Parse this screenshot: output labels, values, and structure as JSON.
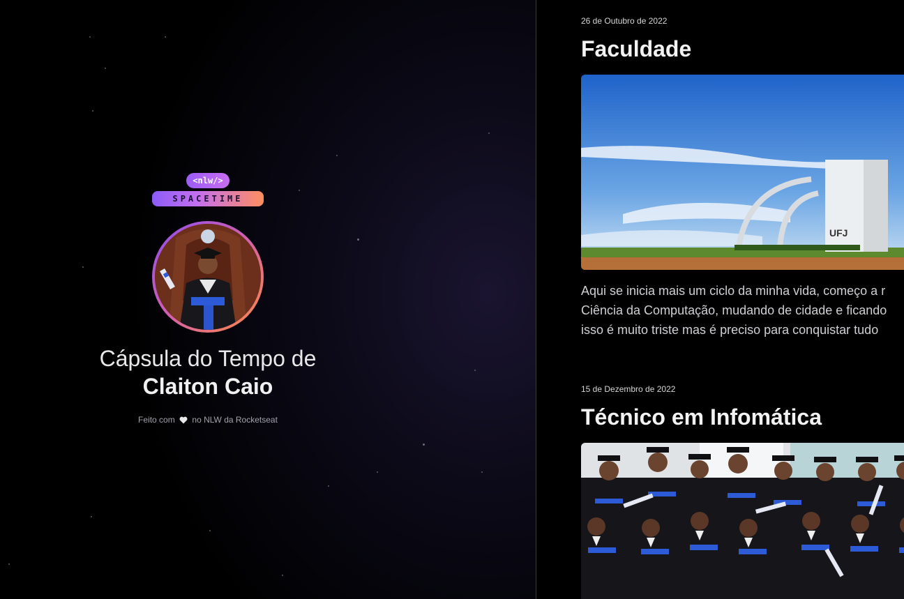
{
  "brand": {
    "tag": "<nlw/>",
    "word": "SPACETIME"
  },
  "profile": {
    "title": "Cápsula do Tempo de",
    "name": "Claiton Caio"
  },
  "footer": {
    "before": "Feito com",
    "after": "no NLW da Rocketseat"
  },
  "memories": [
    {
      "date": "26 de Outubro de 2022",
      "title": "Faculdade",
      "image_caption": "UFJ",
      "text_lines": [
        "Aqui se inicia mais um ciclo da minha vida, começo a r",
        "Ciência da Computação, mudando de cidade e ficando",
        "isso é muito triste mas é preciso para conquistar tudo"
      ]
    },
    {
      "date": "15 de Dezembro de 2022",
      "title": "Técnico em Infomática"
    }
  ],
  "colors": {
    "background": "#000000",
    "accent_purple": "#9b5cf6",
    "accent_orange": "#ff8b3d"
  }
}
